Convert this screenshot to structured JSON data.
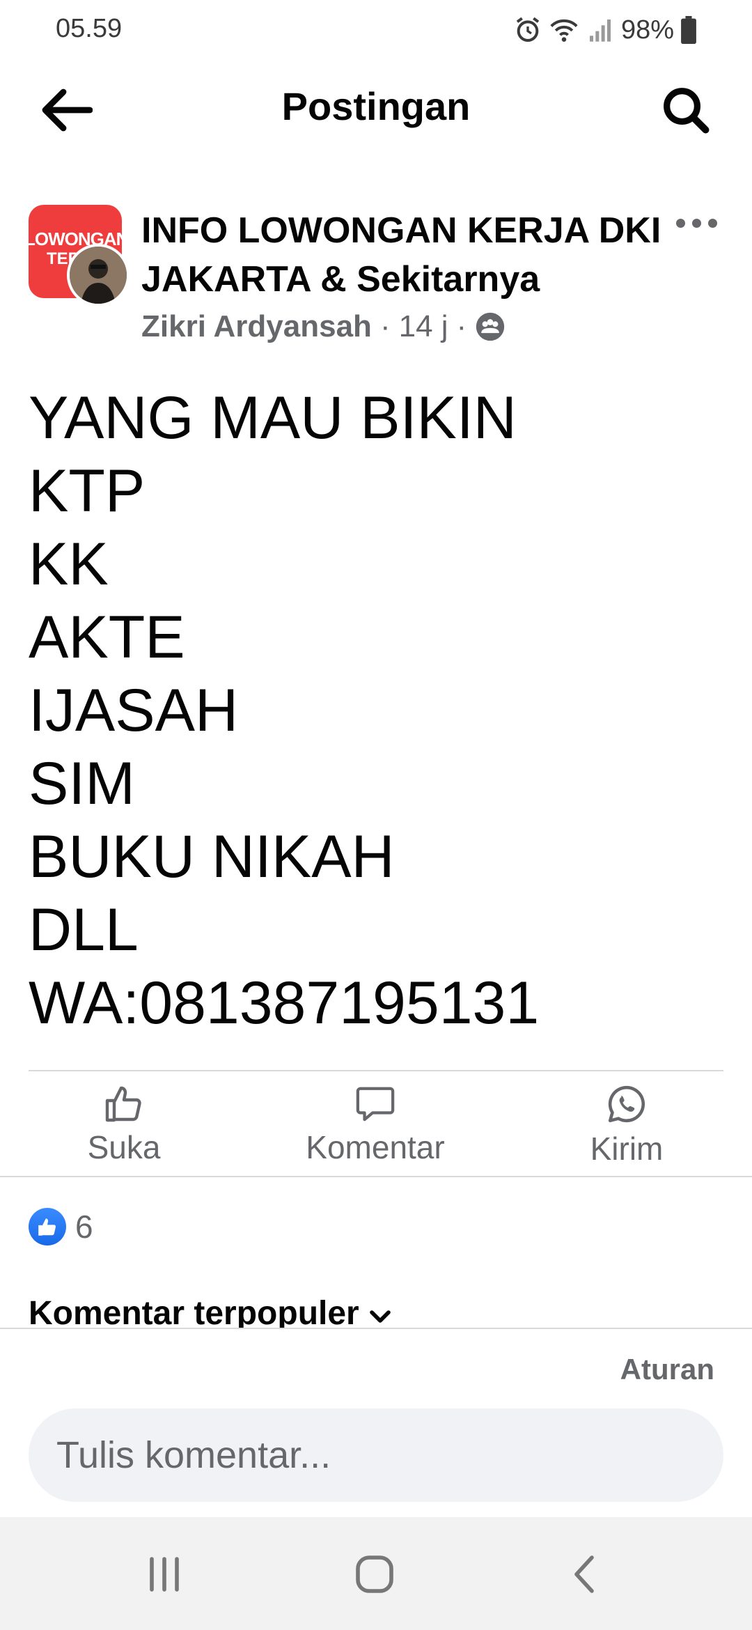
{
  "status_bar": {
    "time": "05.59",
    "battery": "98%"
  },
  "header": {
    "title": "Postingan",
    "back_icon": "arrow-left-icon",
    "search_icon": "search-icon"
  },
  "post": {
    "group_name": "INFO LOWONGAN KERJA DKI JAKARTA & Sekitarnya",
    "group_avatar_text": "LOWONGAN KERJA",
    "group_avatar_text2": "TER",
    "author": "Zikri Ardyansah",
    "time": "14 j",
    "separator": "·",
    "body": "YANG MAU BIKIN\nKTP\nKK\nAKTE\nIJASAH\nSIM\nBUKU NIKAH\nDLL\nWA:081387195131"
  },
  "actions": {
    "like": "Suka",
    "comment": "Komentar",
    "send": "Kirim"
  },
  "reactions": {
    "count": "6"
  },
  "comments": {
    "sort_label": "Komentar terpopuler",
    "rules": "Aturan",
    "placeholder": "Tulis komentar..."
  },
  "colors": {
    "accent": "#1877f2",
    "group_avatar": "#ef3c3c",
    "muted": "#65676b"
  }
}
